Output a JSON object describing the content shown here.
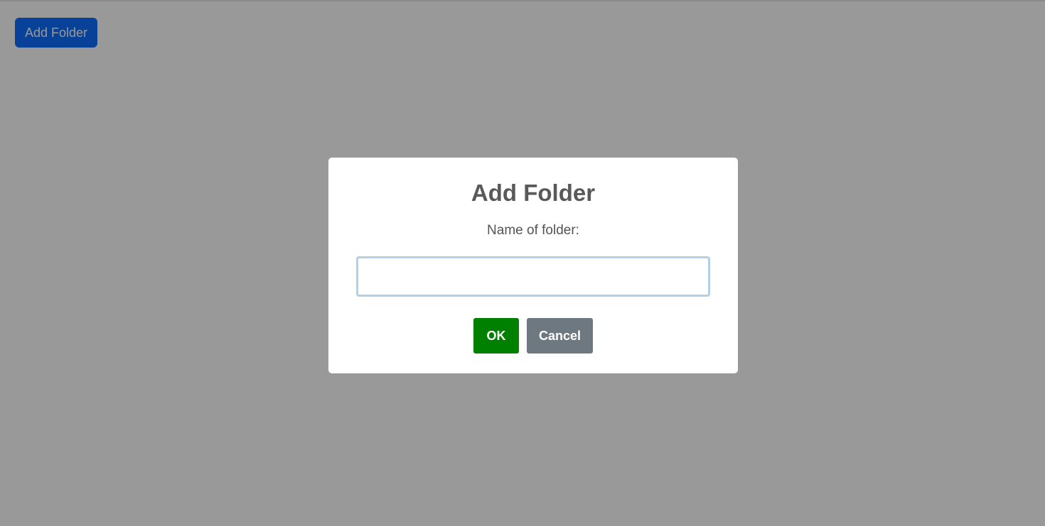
{
  "toolbar": {
    "add_folder_label": "Add Folder"
  },
  "dialog": {
    "title": "Add Folder",
    "label": "Name of folder:",
    "input_value": "",
    "ok_label": "OK",
    "cancel_label": "Cancel"
  },
  "colors": {
    "primary": "#0d6efd",
    "ok": "#008000",
    "cancel": "#6e7881",
    "overlay": "rgba(0,0,0,0.4)"
  }
}
